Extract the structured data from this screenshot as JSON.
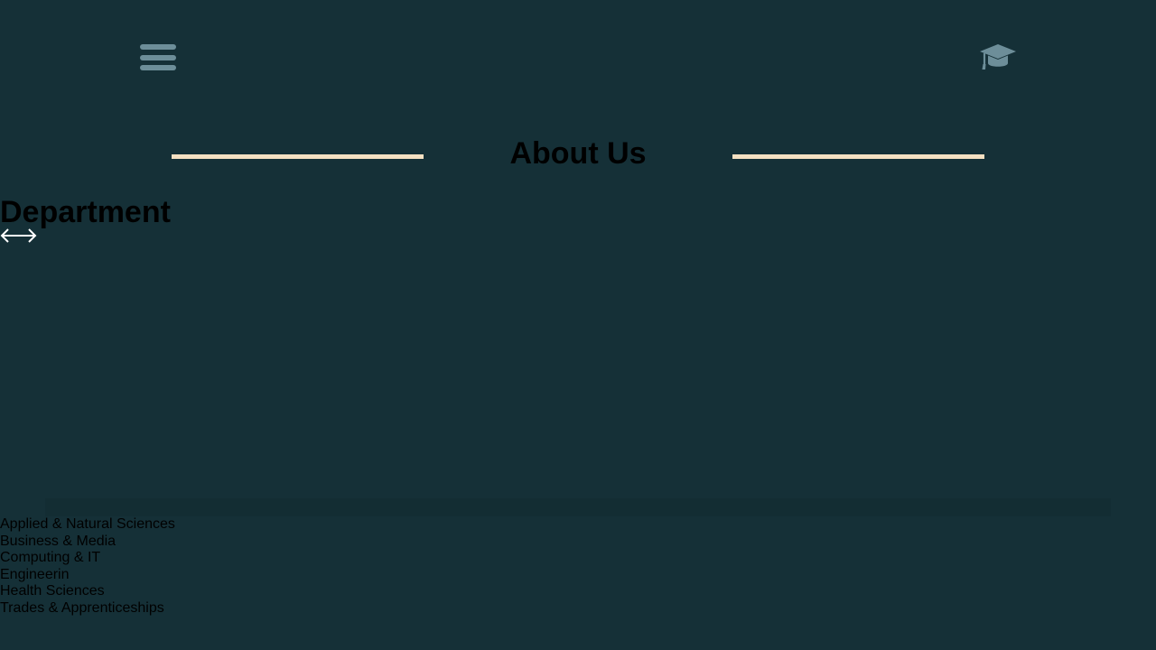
{
  "header": {
    "menu_icon": "hamburger-menu-icon",
    "brand_icon": "graduation-cap-icon",
    "icon_color": "#6d8e99"
  },
  "about": {
    "title": "About Us",
    "rule_color": "#f4e0c2"
  },
  "department": {
    "title": "Department",
    "swipe_icon": "left-right-arrow-icon",
    "items": [
      "Applied & Natural Sciences",
      "Business & Media",
      "Computing & IT",
      "Engineerin",
      "Health Sciences",
      "Trades & Apprenticeships"
    ]
  },
  "colors": {
    "background": "#153037",
    "text": "#000000"
  }
}
